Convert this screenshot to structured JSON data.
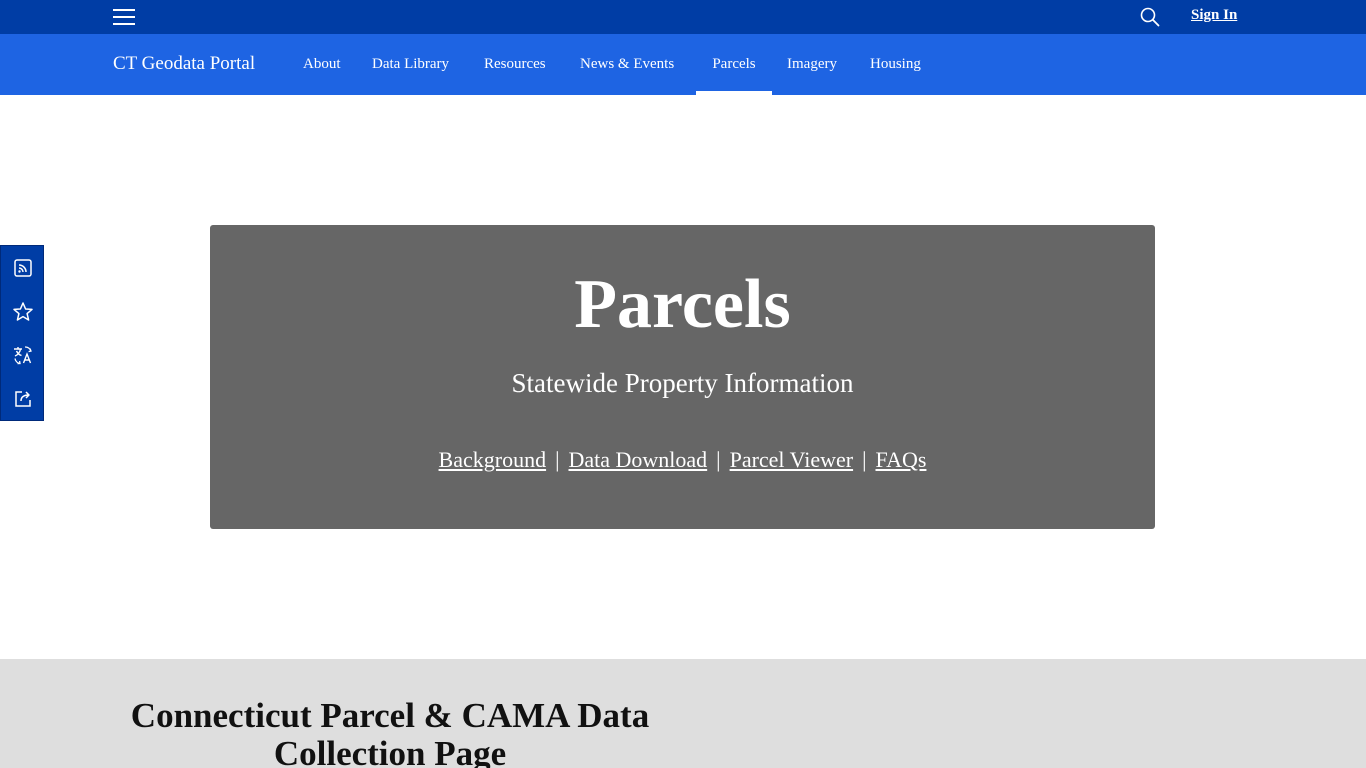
{
  "top_bar": {
    "sign_in_label": "Sign In",
    "menu_icon": "hamburger-menu-icon",
    "search_icon": "search-icon"
  },
  "nav": {
    "site_title": "CT Geodata Portal",
    "items": [
      {
        "label": "About"
      },
      {
        "label": "Data Library"
      },
      {
        "label": "Resources"
      },
      {
        "label": "News & Events"
      },
      {
        "label": "Parcels",
        "active": true
      },
      {
        "label": "Imagery"
      },
      {
        "label": "Housing"
      }
    ]
  },
  "side_toolbar": {
    "icons": [
      "rss-icon",
      "star-icon",
      "translate-icon",
      "share-icon"
    ]
  },
  "hero": {
    "title": "Parcels",
    "subtitle": "Statewide Property Information",
    "links": [
      "Background",
      "Data Download",
      "Parcel Viewer",
      "FAQs"
    ],
    "separator": "|"
  },
  "section": {
    "heading": "Connecticut Parcel & CAMA Data Collection Page"
  },
  "colors": {
    "top_bar": "#003da5",
    "nav_bar": "#1e64e3",
    "hero_bg": "#666666",
    "section_bg": "#dedede"
  }
}
